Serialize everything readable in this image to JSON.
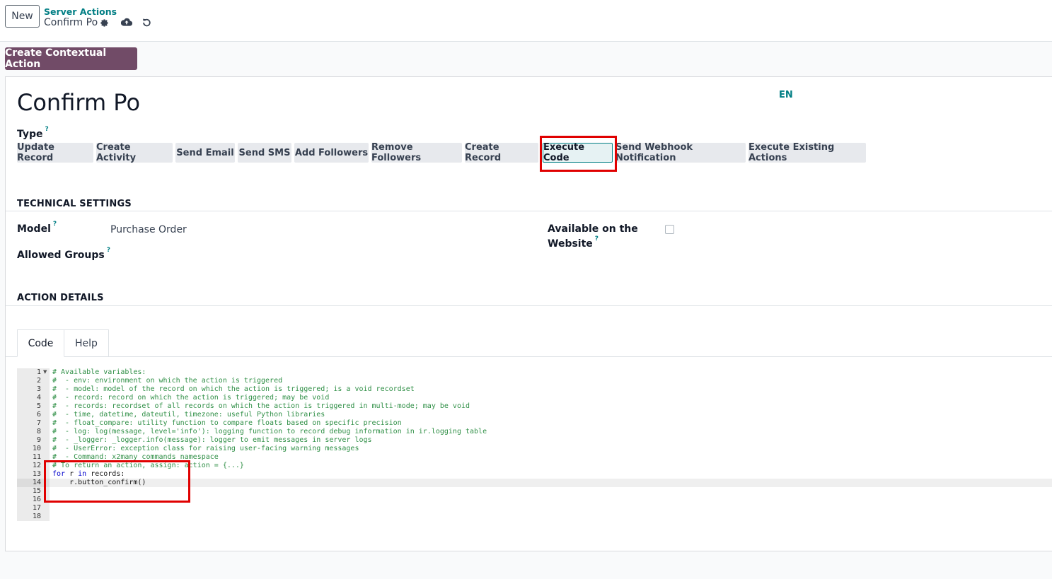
{
  "top": {
    "new_label": "New",
    "breadcrumb_parent": "Server Actions",
    "record_name": "Confirm Po",
    "icons": [
      "gear-icon",
      "cloud-upload-icon",
      "undo-icon"
    ]
  },
  "toolbar": {
    "contextual_label": "Create Contextual Action"
  },
  "form": {
    "title": "Confirm Po",
    "lang": "EN",
    "type_label": "Type",
    "help_mark": "?",
    "types": [
      "Update Record",
      "Create Activity",
      "Send Email",
      "Send SMS",
      "Add Followers",
      "Remove Followers",
      "Create Record",
      "Execute Code",
      "Send Webhook Notification",
      "Execute Existing Actions"
    ],
    "selected_type": "Execute Code",
    "technical_heading": "TECHNICAL SETTINGS",
    "model_label": "Model",
    "model_value": "Purchase Order",
    "groups_label": "Allowed Groups",
    "website_label_1": "Available on the",
    "website_label_2": "Website",
    "website_checked": false,
    "details_heading": "ACTION DETAILS",
    "tabs": [
      "Code",
      "Help"
    ]
  },
  "code": {
    "line_numbers": [
      "1",
      "2",
      "3",
      "4",
      "5",
      "6",
      "7",
      "8",
      "9",
      "10",
      "11",
      "12",
      "13",
      "14",
      "15",
      "16",
      "17",
      "18"
    ],
    "lines": [
      "# Available variables:",
      "#  - env: environment on which the action is triggered",
      "#  - model: model of the record on which the action is triggered; is a void recordset",
      "#  - record: record on which the action is triggered; may be void",
      "#  - records: recordset of all records on which the action is triggered in multi-mode; may be void",
      "#  - time, datetime, dateutil, timezone: useful Python libraries",
      "#  - float_compare: utility function to compare floats based on specific precision",
      "#  - log: log(message, level='info'): logging function to record debug information in ir.logging table",
      "#  - _logger: _logger.info(message): logger to emit messages in server logs",
      "#  - UserError: exception class for raising user-facing warning messages",
      "#  - Command: x2many commands namespace",
      "# To return an action, assign: action = {...}",
      "for r in records:",
      "    r.button_confirm()",
      "",
      "",
      "",
      ""
    ],
    "line13_for": "for",
    "line13_r": " r ",
    "line13_in": "in",
    "line13_rest": " records:"
  },
  "colors": {
    "accent": "#017e84",
    "primary": "#714b67",
    "highlight_box": "#e00000",
    "comment": "#2f8f46",
    "keyword": "#0000cc"
  }
}
